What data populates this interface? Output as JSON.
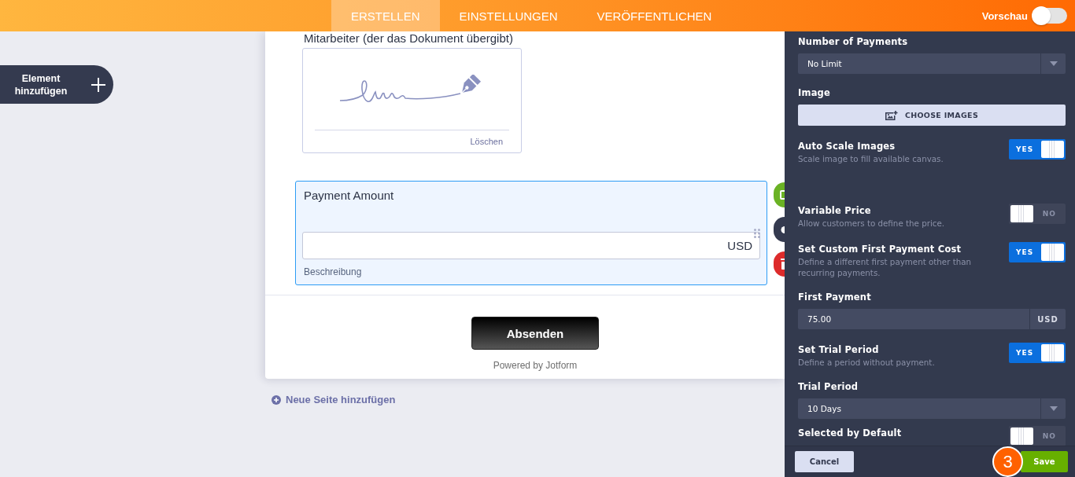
{
  "top_bar": {
    "tabs": [
      {
        "label": "ERSTELLEN",
        "selected": true
      },
      {
        "label": "EINSTELLUNGEN",
        "selected": false
      },
      {
        "label": "VERÖFFENTLICHEN",
        "selected": false
      }
    ],
    "preview": {
      "label": "Vorschau",
      "on": false
    }
  },
  "add_element_button": {
    "label": "Element hinzufügen"
  },
  "form": {
    "signature_field": {
      "label": "Mitarbeiter (der das Dokument übergibt)",
      "clear_link": "Löschen"
    },
    "payment_field": {
      "label": "Payment Amount",
      "currency": "USD",
      "sublabel": "Beschreibung",
      "selected": true
    },
    "submit_button": "Absenden",
    "footer": "Powered by Jotform"
  },
  "add_page_link": "Neue Seite hinzufügen",
  "properties_panel": {
    "fields": [
      {
        "kind": "select",
        "label": "Number of Payments",
        "value": "No Limit"
      },
      {
        "kind": "button",
        "label": "Image",
        "button_label": "CHOOSE IMAGES"
      },
      {
        "kind": "toggle",
        "label": "Auto Scale Images",
        "description": "Scale image to fill available canvas.",
        "on": true,
        "state_text": "YES"
      },
      {
        "kind": "divider"
      },
      {
        "kind": "toggle",
        "label": "Variable Price",
        "description": "Allow customers to define the price.",
        "on": false,
        "state_text": "NO"
      },
      {
        "kind": "toggle",
        "label": "Set Custom First Payment Cost",
        "description": "Define a different first payment other than recurring payments.",
        "on": true,
        "state_text": "YES"
      },
      {
        "kind": "input",
        "label": "First Payment",
        "value": "75.00",
        "suffix": "USD"
      },
      {
        "kind": "toggle",
        "label": "Set Trial Period",
        "description": "Define a period without payment.",
        "on": true,
        "state_text": "YES"
      },
      {
        "kind": "select",
        "label": "Trial Period",
        "value": "10 Days"
      },
      {
        "kind": "toggle",
        "label": "Selected by Default",
        "on": false,
        "state_text": "NO"
      }
    ],
    "cancel_button": "Cancel",
    "save_button": "Save",
    "step_badge": "3"
  }
}
